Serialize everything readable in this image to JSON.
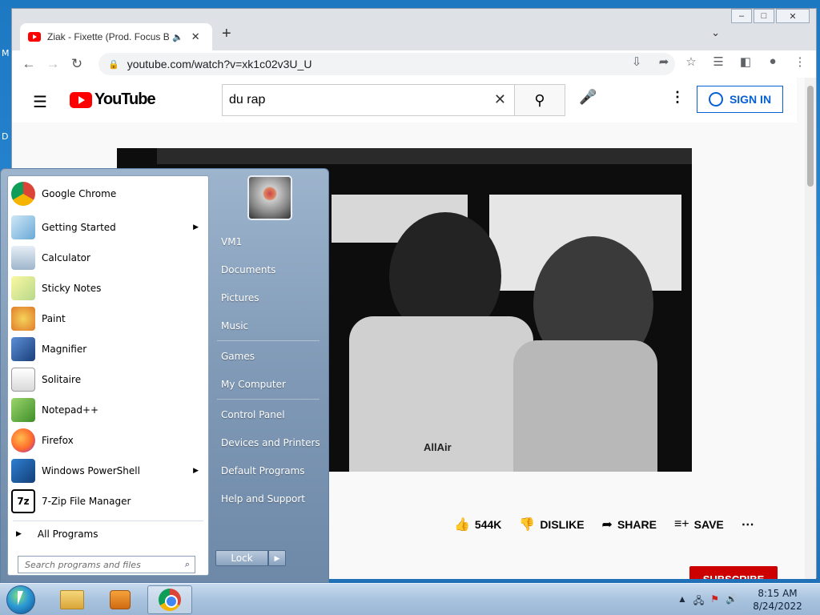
{
  "desktop": {
    "edge_label_1": "M",
    "edge_label_2": "D"
  },
  "browser": {
    "tab_title": "Ziak - Fixette (Prod. Focus Be",
    "new_tab_label": "+",
    "url": "youtube.com/watch?v=xk1c02v3U_U"
  },
  "youtube": {
    "logo_text": "YouTube",
    "search_value": "du rap",
    "signin_label": "SIGN IN",
    "video_overlay_text": "AllAir",
    "actions": {
      "likes": "544K",
      "dislike": "DISLIKE",
      "share": "SHARE",
      "save": "SAVE"
    },
    "subscribe_label": "SUBSCRIBE"
  },
  "start_menu": {
    "programs": [
      {
        "label": "Google Chrome",
        "icon": "chrome-icon",
        "arrow": false
      },
      {
        "label": "Getting Started",
        "icon": "getting-started-icon",
        "arrow": true
      },
      {
        "label": "Calculator",
        "icon": "calculator-icon",
        "arrow": false
      },
      {
        "label": "Sticky Notes",
        "icon": "sticky-notes-icon",
        "arrow": false
      },
      {
        "label": "Paint",
        "icon": "paint-icon",
        "arrow": false
      },
      {
        "label": "Magnifier",
        "icon": "magnifier-icon",
        "arrow": false
      },
      {
        "label": "Solitaire",
        "icon": "solitaire-icon",
        "arrow": false
      },
      {
        "label": "Notepad++",
        "icon": "notepadpp-icon",
        "arrow": false
      },
      {
        "label": "Firefox",
        "icon": "firefox-icon",
        "arrow": false
      },
      {
        "label": "Windows PowerShell",
        "icon": "powershell-icon",
        "arrow": true
      },
      {
        "label": "7-Zip File Manager",
        "icon": "7zip-icon",
        "arrow": false
      }
    ],
    "all_programs": "All Programs",
    "search_placeholder": "Search programs and files",
    "right_items": [
      "VM1",
      "Documents",
      "Pictures",
      "Music",
      "Games",
      "My Computer",
      "Control Panel",
      "Devices and Printers",
      "Default Programs",
      "Help and Support"
    ],
    "lock_label": "Lock"
  },
  "taskbar": {
    "time": "8:15 AM",
    "date": "8/24/2022"
  }
}
